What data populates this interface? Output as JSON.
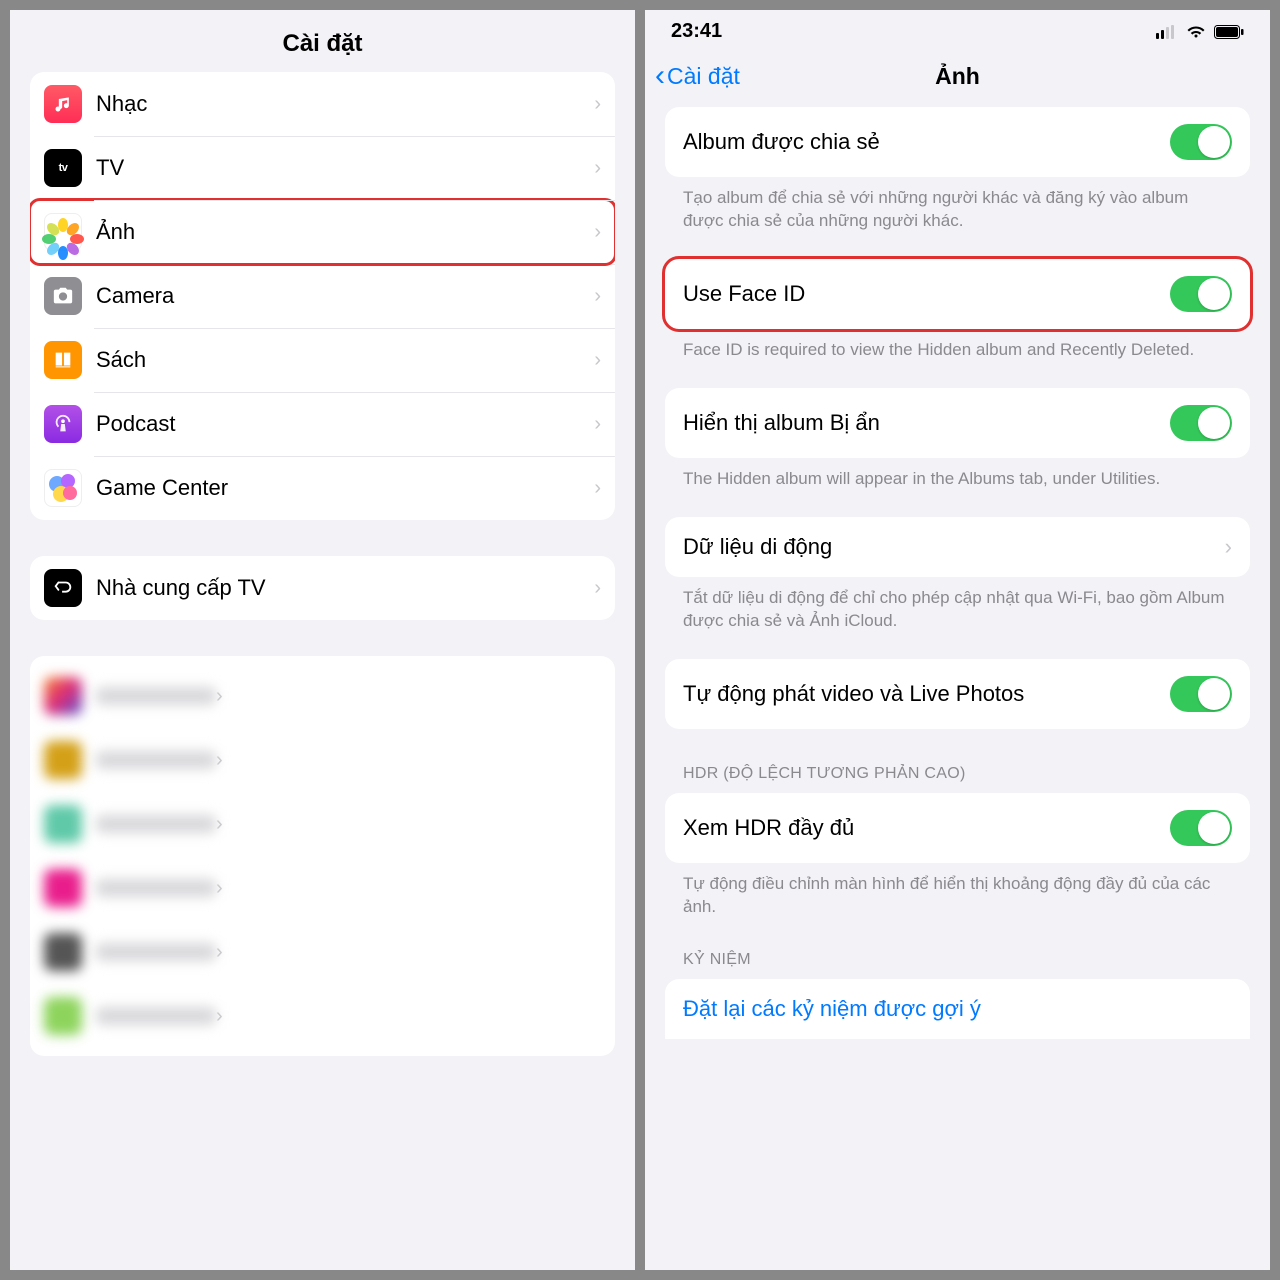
{
  "left": {
    "title": "Cài đặt",
    "group1": [
      {
        "label": "Nhạc"
      },
      {
        "label": "TV"
      },
      {
        "label": "Ảnh"
      },
      {
        "label": "Camera"
      },
      {
        "label": "Sách"
      },
      {
        "label": "Podcast"
      },
      {
        "label": "Game Center"
      }
    ],
    "group2": [
      {
        "label": "Nhà cung cấp TV"
      }
    ]
  },
  "right": {
    "status_time": "23:41",
    "back_label": "Cài đặt",
    "title": "Ảnh",
    "shared_album": {
      "label": "Album được chia sẻ",
      "footer": "Tạo album để chia sẻ với những người khác và đăng ký vào album được chia sẻ của những người khác."
    },
    "faceid": {
      "label": "Use Face ID",
      "footer": "Face ID is required to view the Hidden album and Recently Deleted."
    },
    "hidden": {
      "label": "Hiển thị album Bị ẩn",
      "footer": "The Hidden album will appear in the Albums tab, under Utilities."
    },
    "cellular": {
      "label": "Dữ liệu di động",
      "footer": "Tắt dữ liệu di động để chỉ cho phép cập nhật qua Wi-Fi, bao gồm Album được chia sẻ và Ảnh iCloud."
    },
    "autoplay": {
      "label": "Tự động phát video và Live Photos"
    },
    "hdr_header": "HDR (ĐỘ LỆCH TƯƠNG PHẢN CAO)",
    "hdr": {
      "label": "Xem HDR đầy đủ",
      "footer": "Tự động điều chỉnh màn hình để hiển thị khoảng động đầy đủ của các ảnh."
    },
    "memories_header": "KỶ NIỆM",
    "memories_reset": "Đặt lại các kỷ niệm được gợi ý"
  }
}
